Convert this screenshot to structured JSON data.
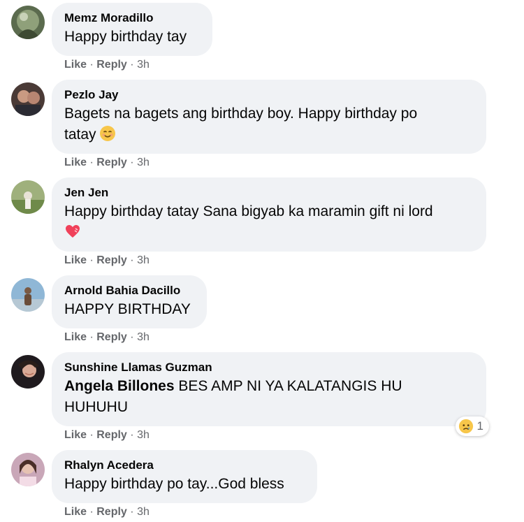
{
  "comments": [
    {
      "author": "Memz Moradillo",
      "lines": [
        "Happy birthday tay"
      ],
      "actions": {
        "like": "Like",
        "reply": "Reply",
        "sep": "·",
        "time": "3h"
      }
    },
    {
      "author": "Pezlo Jay",
      "lines": [
        "Bagets na bagets ang birthday boy. Happy birthday po",
        "tatay"
      ],
      "emoji": "smiling-face-icon",
      "actions": {
        "like": "Like",
        "reply": "Reply",
        "sep": "·",
        "time": "3h"
      }
    },
    {
      "author": "Jen Jen",
      "lines": [
        "Happy birthday tatay Sana bigyab ka maramin gift ni lord"
      ],
      "emoji": "heart-icon",
      "actions": {
        "like": "Like",
        "reply": "Reply",
        "sep": "·",
        "time": "3h"
      }
    },
    {
      "author": "Arnold Bahia Dacillo",
      "lines": [
        "HAPPY BIRTHDAY"
      ],
      "actions": {
        "like": "Like",
        "reply": "Reply",
        "sep": "·",
        "time": "3h"
      }
    },
    {
      "author": "Sunshine Llamas Guzman",
      "mention": "Angela Billones",
      "lines": [
        "BES AMP NI YA KALATANGIS HU",
        "HUHUHU"
      ],
      "reaction": {
        "icon": "sad-reaction-icon",
        "count": "1"
      },
      "actions": {
        "like": "Like",
        "reply": "Reply",
        "sep": "·",
        "time": "3h"
      }
    },
    {
      "author": "Rhalyn Acedera",
      "lines": [
        "Happy birthday po tay...God bless"
      ],
      "actions": {
        "like": "Like",
        "reply": "Reply",
        "sep": "·",
        "time": "3h"
      }
    }
  ],
  "colors": {
    "bubble": "#f0f2f5",
    "meta": "#65676b",
    "text": "#050505"
  }
}
